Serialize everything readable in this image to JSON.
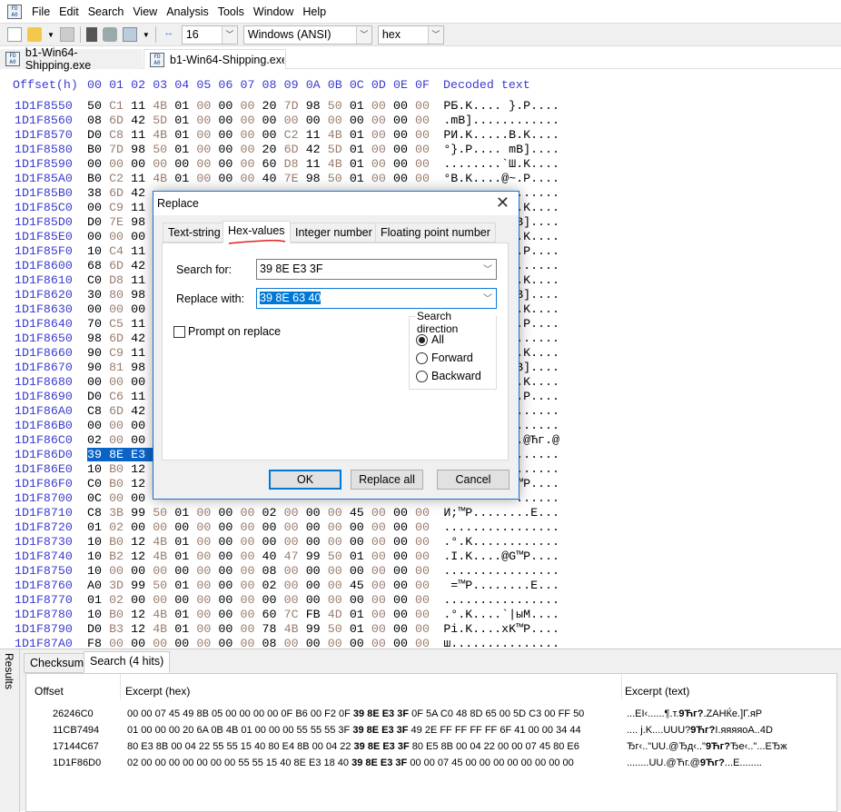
{
  "menu": [
    "File",
    "Edit",
    "Search",
    "View",
    "Analysis",
    "Tools",
    "Window",
    "Help"
  ],
  "toolbar": {
    "bytes_per_row": "16",
    "charset": "Windows (ANSI)",
    "offset_base": "hex"
  },
  "file_tabs": [
    {
      "label": "b1-Win64-Shipping.exe",
      "active": false
    },
    {
      "label": "b1-Win64-Shipping.exe",
      "active": true
    }
  ],
  "hexview": {
    "header_offset": "Offset(h)",
    "header_cols": [
      "00",
      "01",
      "02",
      "03",
      "04",
      "05",
      "06",
      "07",
      "08",
      "09",
      "0A",
      "0B",
      "0C",
      "0D",
      "0E",
      "0F"
    ],
    "header_decoded": "Decoded text",
    "rows": [
      {
        "offset": "1D1F8550",
        "bytes": [
          "50",
          "C1",
          "11",
          "4B",
          "01",
          "00",
          "00",
          "00",
          "20",
          "7D",
          "98",
          "50",
          "01",
          "00",
          "00",
          "00"
        ],
        "decoded": "РБ.K.... }.P...."
      },
      {
        "offset": "1D1F8560",
        "bytes": [
          "08",
          "6D",
          "42",
          "5D",
          "01",
          "00",
          "00",
          "00",
          "00",
          "00",
          "00",
          "00",
          "00",
          "00",
          "00",
          "00"
        ],
        "decoded": ".mB]............"
      },
      {
        "offset": "1D1F8570",
        "bytes": [
          "D0",
          "C8",
          "11",
          "4B",
          "01",
          "00",
          "00",
          "00",
          "00",
          "C2",
          "11",
          "4B",
          "01",
          "00",
          "00",
          "00"
        ],
        "decoded": "РИ.K.....В.K...."
      },
      {
        "offset": "1D1F8580",
        "bytes": [
          "B0",
          "7D",
          "98",
          "50",
          "01",
          "00",
          "00",
          "00",
          "20",
          "6D",
          "42",
          "5D",
          "01",
          "00",
          "00",
          "00"
        ],
        "decoded": "°}.P.... mB]...."
      },
      {
        "offset": "1D1F8590",
        "bytes": [
          "00",
          "00",
          "00",
          "00",
          "00",
          "00",
          "00",
          "00",
          "60",
          "D8",
          "11",
          "4B",
          "01",
          "00",
          "00",
          "00"
        ],
        "decoded": "........`Ш.K...."
      },
      {
        "offset": "1D1F85A0",
        "bytes": [
          "B0",
          "C2",
          "11",
          "4B",
          "01",
          "00",
          "00",
          "00",
          "40",
          "7E",
          "98",
          "50",
          "01",
          "00",
          "00",
          "00"
        ],
        "decoded": "°В.K....@~.P...."
      },
      {
        "offset": "1D1F85B0",
        "bytes": [
          "38",
          "6D",
          "42"
        ],
        "decoded": "......"
      },
      {
        "offset": "1D1F85C0",
        "bytes": [
          "00",
          "C9",
          "11"
        ],
        "decoded": ".K...."
      },
      {
        "offset": "1D1F85D0",
        "bytes": [
          "D0",
          "7E",
          "98"
        ],
        "decoded": "B]...."
      },
      {
        "offset": "1D1F85E0",
        "bytes": [
          "00",
          "00",
          "00"
        ],
        "decoded": ".K...."
      },
      {
        "offset": "1D1F85F0",
        "bytes": [
          "10",
          "C4",
          "11"
        ],
        "decoded": ".P...."
      },
      {
        "offset": "1D1F8600",
        "bytes": [
          "68",
          "6D",
          "42"
        ],
        "decoded": "......"
      },
      {
        "offset": "1D1F8610",
        "bytes": [
          "C0",
          "D8",
          "11"
        ],
        "decoded": ".K...."
      },
      {
        "offset": "1D1F8620",
        "bytes": [
          "30",
          "80",
          "98"
        ],
        "decoded": "B]...."
      },
      {
        "offset": "1D1F8630",
        "bytes": [
          "00",
          "00",
          "00"
        ],
        "decoded": ".K...."
      },
      {
        "offset": "1D1F8640",
        "bytes": [
          "70",
          "C5",
          "11"
        ],
        "decoded": ".P...."
      },
      {
        "offset": "1D1F8650",
        "bytes": [
          "98",
          "6D",
          "42"
        ],
        "decoded": "......"
      },
      {
        "offset": "1D1F8660",
        "bytes": [
          "90",
          "C9",
          "11"
        ],
        "decoded": ".K...."
      },
      {
        "offset": "1D1F8670",
        "bytes": [
          "90",
          "81",
          "98"
        ],
        "decoded": "B]...."
      },
      {
        "offset": "1D1F8680",
        "bytes": [
          "00",
          "00",
          "00"
        ],
        "decoded": ".K...."
      },
      {
        "offset": "1D1F8690",
        "bytes": [
          "D0",
          "C6",
          "11"
        ],
        "decoded": ".P...."
      },
      {
        "offset": "1D1F86A0",
        "bytes": [
          "C8",
          "6D",
          "42"
        ],
        "decoded": "......"
      },
      {
        "offset": "1D1F86B0",
        "bytes": [
          "00",
          "00",
          "00"
        ],
        "decoded": "......"
      },
      {
        "offset": "1D1F86C0",
        "bytes": [
          "02",
          "00",
          "00"
        ],
        "decoded": ".@Ћг.@"
      },
      {
        "offset": "1D1F86D0",
        "bytes": [
          "39",
          "8E",
          "E3"
        ],
        "decoded": "......",
        "selected_bytes": 3
      },
      {
        "offset": "1D1F86E0",
        "bytes": [
          "10",
          "B0",
          "12"
        ],
        "decoded": "......"
      },
      {
        "offset": "1D1F86F0",
        "bytes": [
          "C0",
          "B0",
          "12"
        ],
        "decoded": "™P...."
      },
      {
        "offset": "1D1F8700",
        "bytes": [
          "0C",
          "00",
          "00"
        ],
        "decoded": "......"
      },
      {
        "offset": "1D1F8710",
        "bytes": [
          "C8",
          "3B",
          "99",
          "50",
          "01",
          "00",
          "00",
          "00",
          "02",
          "00",
          "00",
          "00",
          "45",
          "00",
          "00",
          "00"
        ],
        "decoded": "И;™P........E..."
      },
      {
        "offset": "1D1F8720",
        "bytes": [
          "01",
          "02",
          "00",
          "00",
          "00",
          "00",
          "00",
          "00",
          "00",
          "00",
          "00",
          "00",
          "00",
          "00",
          "00",
          "00"
        ],
        "decoded": "................"
      },
      {
        "offset": "1D1F8730",
        "bytes": [
          "10",
          "B0",
          "12",
          "4B",
          "01",
          "00",
          "00",
          "00",
          "00",
          "00",
          "00",
          "00",
          "00",
          "00",
          "00",
          "00"
        ],
        "decoded": ".°.K............"
      },
      {
        "offset": "1D1F8740",
        "bytes": [
          "10",
          "B2",
          "12",
          "4B",
          "01",
          "00",
          "00",
          "00",
          "40",
          "47",
          "99",
          "50",
          "01",
          "00",
          "00",
          "00"
        ],
        "decoded": ".І.K....@G™P...."
      },
      {
        "offset": "1D1F8750",
        "bytes": [
          "10",
          "00",
          "00",
          "00",
          "00",
          "00",
          "00",
          "00",
          "08",
          "00",
          "00",
          "00",
          "00",
          "00",
          "00",
          "00"
        ],
        "decoded": "................"
      },
      {
        "offset": "1D1F8760",
        "bytes": [
          "A0",
          "3D",
          "99",
          "50",
          "01",
          "00",
          "00",
          "00",
          "02",
          "00",
          "00",
          "00",
          "45",
          "00",
          "00",
          "00"
        ],
        "decoded": " =™P........E..."
      },
      {
        "offset": "1D1F8770",
        "bytes": [
          "01",
          "02",
          "00",
          "00",
          "00",
          "00",
          "00",
          "00",
          "00",
          "00",
          "00",
          "00",
          "00",
          "00",
          "00",
          "00"
        ],
        "decoded": "................"
      },
      {
        "offset": "1D1F8780",
        "bytes": [
          "10",
          "B0",
          "12",
          "4B",
          "01",
          "00",
          "00",
          "00",
          "60",
          "7C",
          "FB",
          "4D",
          "01",
          "00",
          "00",
          "00"
        ],
        "decoded": ".°.K....`|ыM...."
      },
      {
        "offset": "1D1F8790",
        "bytes": [
          "D0",
          "B3",
          "12",
          "4B",
          "01",
          "00",
          "00",
          "00",
          "78",
          "4B",
          "99",
          "50",
          "01",
          "00",
          "00",
          "00"
        ],
        "decoded": "Рі.K....xK™P...."
      },
      {
        "offset": "1D1F87A0",
        "bytes": [
          "F8",
          "00",
          "00",
          "00",
          "00",
          "00",
          "00",
          "00",
          "08",
          "00",
          "00",
          "00",
          "00",
          "00",
          "00",
          "00"
        ],
        "decoded": "ш..............."
      }
    ]
  },
  "dialog": {
    "title": "Replace",
    "tabs": [
      "Text-string",
      "Hex-values",
      "Integer number",
      "Floating point number"
    ],
    "active_tab": 1,
    "search_label": "Search for:",
    "search_value": "39 8E E3 3F",
    "replace_label": "Replace with:",
    "replace_value": "39 8E 63 40",
    "prompt_label": "Prompt on replace",
    "prompt_checked": false,
    "direction_title": "Search direction",
    "directions": [
      "All",
      "Forward",
      "Backward"
    ],
    "direction_selected": 0,
    "ok": "OK",
    "replace_all": "Replace all",
    "cancel": "Cancel",
    "accent": "#0078d7"
  },
  "results": {
    "side_label": "Results",
    "tabs": [
      "Checksum",
      "Search (4 hits)"
    ],
    "columns": [
      "Offset",
      "Excerpt (hex)",
      "Excerpt (text)"
    ],
    "rows": [
      {
        "offset": "26246C0",
        "hex_before": "00 00 07 45 49 8B 05 00 00 00 00 0F B6 00 F2 0F ",
        "hex_match": "39 8E E3 3F",
        "hex_after": " 0F 5A C0 48 8D 65 00 5D C3 00 FF 50",
        "text_before": "...EI‹......¶.т.",
        "text_match": "9Ћг?",
        "text_after": ".ZAHЌe.]Г.яР"
      },
      {
        "offset": "11CB7494",
        "hex_before": "01 00 00 00 20 6A 0B 4B 01 00 00 00 55 55 55 3F ",
        "hex_match": "39 8E E3 3F",
        "hex_after": " 49 2E FF FF FF FF 6F 41 00 00 34 44",
        "text_before": ".... j.K....UUU?",
        "text_match": "9Ћг?",
        "text_after": "I.яяяяoA..4D"
      },
      {
        "offset": "17144C67",
        "hex_before": "80 E3 8B 00 04 22 55 55 15 40 80 E4 8B 00 04 22 ",
        "hex_match": "39 8E E3 3F",
        "hex_after": " 80 E5 8B 00 04 22 00 00 07 45 80 E6",
        "text_before": "Ђг‹..\"UU.@Ђд‹..\"",
        "text_match": "9Ћг?",
        "text_after": "Ђе‹..\"...EЂж"
      },
      {
        "offset": "1D1F86D0",
        "hex_before": "02 00 00 00 00 00 00 00 55 55 15 40 8E E3 18 40 ",
        "hex_match": "39 8E E3 3F",
        "hex_after": " 00 00 07 45 00 00 00 00 00 00 00 00",
        "text_before": "........UU.@Ћг.@",
        "text_match": "9Ћг?",
        "text_after": "...E........"
      }
    ]
  }
}
